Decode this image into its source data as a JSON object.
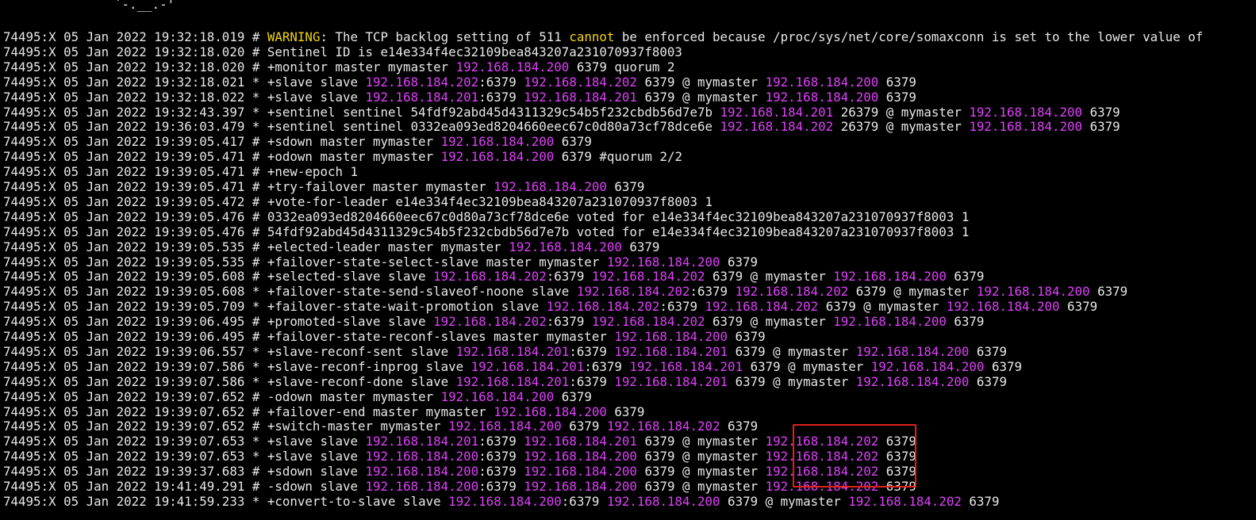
{
  "terminal": {
    "ascii_fragment": "`-.__.-'",
    "lines": [
      [
        {
          "t": "74495:X 05 Jan 2022 19:32:18.019 # "
        },
        {
          "t": "WARNING",
          "c": "warn"
        },
        {
          "t": ": The TCP backlog setting of 511 "
        },
        {
          "t": "cannot",
          "c": "warn"
        },
        {
          "t": " be enforced because /proc/sys/net/core/somaxconn is set to the lower value of"
        }
      ],
      [
        {
          "t": "74495:X 05 Jan 2022 19:32:18.020 # Sentinel ID is e14e334f4ec32109bea843207a231070937f8003"
        }
      ],
      [
        {
          "t": "74495:X 05 Jan 2022 19:32:18.020 # +monitor master mymaster "
        },
        {
          "t": "192.168.184.200",
          "c": "ip"
        },
        {
          "t": " 6379 quorum 2"
        }
      ],
      [
        {
          "t": "74495:X 05 Jan 2022 19:32:18.021 * +slave slave "
        },
        {
          "t": "192.168.184.202",
          "c": "ip"
        },
        {
          "t": ":6379 "
        },
        {
          "t": "192.168.184.202",
          "c": "ip"
        },
        {
          "t": " 6379 @ mymaster "
        },
        {
          "t": "192.168.184.200",
          "c": "ip"
        },
        {
          "t": " 6379"
        }
      ],
      [
        {
          "t": "74495:X 05 Jan 2022 19:32:18.022 * +slave slave "
        },
        {
          "t": "192.168.184.201",
          "c": "ip"
        },
        {
          "t": ":6379 "
        },
        {
          "t": "192.168.184.201",
          "c": "ip"
        },
        {
          "t": " 6379 @ mymaster "
        },
        {
          "t": "192.168.184.200",
          "c": "ip"
        },
        {
          "t": " 6379"
        }
      ],
      [
        {
          "t": "74495:X 05 Jan 2022 19:32:43.397 * +sentinel sentinel 54fdf92abd45d4311329c54b5f232cbdb56d7e7b "
        },
        {
          "t": "192.168.184.201",
          "c": "ip"
        },
        {
          "t": " 26379 @ mymaster "
        },
        {
          "t": "192.168.184.200",
          "c": "ip"
        },
        {
          "t": " 6379"
        }
      ],
      [
        {
          "t": "74495:X 05 Jan 2022 19:36:03.479 * +sentinel sentinel 0332ea093ed8204660eec67c0d80a73cf78dce6e "
        },
        {
          "t": "192.168.184.202",
          "c": "ip"
        },
        {
          "t": " 26379 @ mymaster "
        },
        {
          "t": "192.168.184.200",
          "c": "ip"
        },
        {
          "t": " 6379"
        }
      ],
      [
        {
          "t": "74495:X 05 Jan 2022 19:39:05.417 # +sdown master mymaster "
        },
        {
          "t": "192.168.184.200",
          "c": "ip"
        },
        {
          "t": " 6379"
        }
      ],
      [
        {
          "t": "74495:X 05 Jan 2022 19:39:05.471 # +odown master mymaster "
        },
        {
          "t": "192.168.184.200",
          "c": "ip"
        },
        {
          "t": " 6379 #quorum 2/2"
        }
      ],
      [
        {
          "t": "74495:X 05 Jan 2022 19:39:05.471 # +new-epoch 1"
        }
      ],
      [
        {
          "t": "74495:X 05 Jan 2022 19:39:05.471 # +try-failover master mymaster "
        },
        {
          "t": "192.168.184.200",
          "c": "ip"
        },
        {
          "t": " 6379"
        }
      ],
      [
        {
          "t": "74495:X 05 Jan 2022 19:39:05.472 # +vote-for-leader e14e334f4ec32109bea843207a231070937f8003 1"
        }
      ],
      [
        {
          "t": "74495:X 05 Jan 2022 19:39:05.476 # 0332ea093ed8204660eec67c0d80a73cf78dce6e voted for e14e334f4ec32109bea843207a231070937f8003 1"
        }
      ],
      [
        {
          "t": "74495:X 05 Jan 2022 19:39:05.476 # 54fdf92abd45d4311329c54b5f232cbdb56d7e7b voted for e14e334f4ec32109bea843207a231070937f8003 1"
        }
      ],
      [
        {
          "t": "74495:X 05 Jan 2022 19:39:05.535 # +elected-leader master mymaster "
        },
        {
          "t": "192.168.184.200",
          "c": "ip"
        },
        {
          "t": " 6379"
        }
      ],
      [
        {
          "t": "74495:X 05 Jan 2022 19:39:05.535 # +failover-state-select-slave master mymaster "
        },
        {
          "t": "192.168.184.200",
          "c": "ip"
        },
        {
          "t": " 6379"
        }
      ],
      [
        {
          "t": "74495:X 05 Jan 2022 19:39:05.608 # +selected-slave slave "
        },
        {
          "t": "192.168.184.202",
          "c": "ip"
        },
        {
          "t": ":6379 "
        },
        {
          "t": "192.168.184.202",
          "c": "ip"
        },
        {
          "t": " 6379 @ mymaster "
        },
        {
          "t": "192.168.184.200",
          "c": "ip"
        },
        {
          "t": " 6379"
        }
      ],
      [
        {
          "t": "74495:X 05 Jan 2022 19:39:05.608 * +failover-state-send-slaveof-noone slave "
        },
        {
          "t": "192.168.184.202",
          "c": "ip"
        },
        {
          "t": ":6379 "
        },
        {
          "t": "192.168.184.202",
          "c": "ip"
        },
        {
          "t": " 6379 @ mymaster "
        },
        {
          "t": "192.168.184.200",
          "c": "ip"
        },
        {
          "t": " 6379"
        }
      ],
      [
        {
          "t": "74495:X 05 Jan 2022 19:39:05.709 * +failover-state-wait-promotion slave "
        },
        {
          "t": "192.168.184.202",
          "c": "ip"
        },
        {
          "t": ":6379 "
        },
        {
          "t": "192.168.184.202",
          "c": "ip"
        },
        {
          "t": " 6379 @ mymaster "
        },
        {
          "t": "192.168.184.200",
          "c": "ip"
        },
        {
          "t": " 6379"
        }
      ],
      [
        {
          "t": "74495:X 05 Jan 2022 19:39:06.495 # +promoted-slave slave "
        },
        {
          "t": "192.168.184.202",
          "c": "ip"
        },
        {
          "t": ":6379 "
        },
        {
          "t": "192.168.184.202",
          "c": "ip"
        },
        {
          "t": " 6379 @ mymaster "
        },
        {
          "t": "192.168.184.200",
          "c": "ip"
        },
        {
          "t": " 6379"
        }
      ],
      [
        {
          "t": "74495:X 05 Jan 2022 19:39:06.495 # +failover-state-reconf-slaves master mymaster "
        },
        {
          "t": "192.168.184.200",
          "c": "ip"
        },
        {
          "t": " 6379"
        }
      ],
      [
        {
          "t": "74495:X 05 Jan 2022 19:39:06.557 * +slave-reconf-sent slave "
        },
        {
          "t": "192.168.184.201",
          "c": "ip"
        },
        {
          "t": ":6379 "
        },
        {
          "t": "192.168.184.201",
          "c": "ip"
        },
        {
          "t": " 6379 @ mymaster "
        },
        {
          "t": "192.168.184.200",
          "c": "ip"
        },
        {
          "t": " 6379"
        }
      ],
      [
        {
          "t": "74495:X 05 Jan 2022 19:39:07.586 * +slave-reconf-inprog slave "
        },
        {
          "t": "192.168.184.201",
          "c": "ip"
        },
        {
          "t": ":6379 "
        },
        {
          "t": "192.168.184.201",
          "c": "ip"
        },
        {
          "t": " 6379 @ mymaster "
        },
        {
          "t": "192.168.184.200",
          "c": "ip"
        },
        {
          "t": " 6379"
        }
      ],
      [
        {
          "t": "74495:X 05 Jan 2022 19:39:07.586 * +slave-reconf-done slave "
        },
        {
          "t": "192.168.184.201",
          "c": "ip"
        },
        {
          "t": ":6379 "
        },
        {
          "t": "192.168.184.201",
          "c": "ip"
        },
        {
          "t": " 6379 @ mymaster "
        },
        {
          "t": "192.168.184.200",
          "c": "ip"
        },
        {
          "t": " 6379"
        }
      ],
      [
        {
          "t": "74495:X 05 Jan 2022 19:39:07.652 # -odown master mymaster "
        },
        {
          "t": "192.168.184.200",
          "c": "ip"
        },
        {
          "t": " 6379"
        }
      ],
      [
        {
          "t": "74495:X 05 Jan 2022 19:39:07.652 # +failover-end master mymaster "
        },
        {
          "t": "192.168.184.200",
          "c": "ip"
        },
        {
          "t": " 6379"
        }
      ],
      [
        {
          "t": "74495:X 05 Jan 2022 19:39:07.652 # +switch-master mymaster "
        },
        {
          "t": "192.168.184.200",
          "c": "ip"
        },
        {
          "t": " 6379 "
        },
        {
          "t": "192.168.184.202",
          "c": "ip"
        },
        {
          "t": " 6379"
        }
      ],
      [
        {
          "t": "74495:X 05 Jan 2022 19:39:07.653 * +slave slave "
        },
        {
          "t": "192.168.184.201",
          "c": "ip"
        },
        {
          "t": ":6379 "
        },
        {
          "t": "192.168.184.201",
          "c": "ip"
        },
        {
          "t": " 6379 @ mymaster "
        },
        {
          "t": "192.168.184.202",
          "c": "ip"
        },
        {
          "t": " 6379"
        }
      ],
      [
        {
          "t": "74495:X 05 Jan 2022 19:39:07.653 * +slave slave "
        },
        {
          "t": "192.168.184.200",
          "c": "ip"
        },
        {
          "t": ":6379 "
        },
        {
          "t": "192.168.184.200",
          "c": "ip"
        },
        {
          "t": " 6379 @ mymaster "
        },
        {
          "t": "192.168.184.202",
          "c": "ip"
        },
        {
          "t": " 6379"
        }
      ],
      [
        {
          "t": "74495:X 05 Jan 2022 19:39:37.683 # +sdown slave "
        },
        {
          "t": "192.168.184.200",
          "c": "ip"
        },
        {
          "t": ":6379 "
        },
        {
          "t": "192.168.184.200",
          "c": "ip"
        },
        {
          "t": " 6379 @ mymaster "
        },
        {
          "t": "192.168.184.202",
          "c": "ip"
        },
        {
          "t": " 6379"
        }
      ],
      [
        {
          "t": "74495:X 05 Jan 2022 19:41:49.291 # -sdown slave "
        },
        {
          "t": "192.168.184.200",
          "c": "ip"
        },
        {
          "t": ":6379 "
        },
        {
          "t": "192.168.184.200",
          "c": "ip"
        },
        {
          "t": " 6379 @ mymaster "
        },
        {
          "t": "192.168.184.202",
          "c": "ip"
        },
        {
          "t": " 6379"
        }
      ],
      [
        {
          "t": "74495:X 05 Jan 2022 19:41:59.233 * +convert-to-slave slave "
        },
        {
          "t": "192.168.184.200",
          "c": "ip"
        },
        {
          "t": ":6379 "
        },
        {
          "t": "192.168.184.200",
          "c": "ip"
        },
        {
          "t": " 6379 @ mymaster "
        },
        {
          "t": "192.168.184.202",
          "c": "ip"
        },
        {
          "t": " 6379"
        }
      ]
    ],
    "prompt": "^A"
  },
  "colors": {
    "background": "#000000",
    "text": "#e8e8e8",
    "ip": "#e040fb",
    "warning": "#f2d50f",
    "highlight_box": "#e0201c"
  }
}
